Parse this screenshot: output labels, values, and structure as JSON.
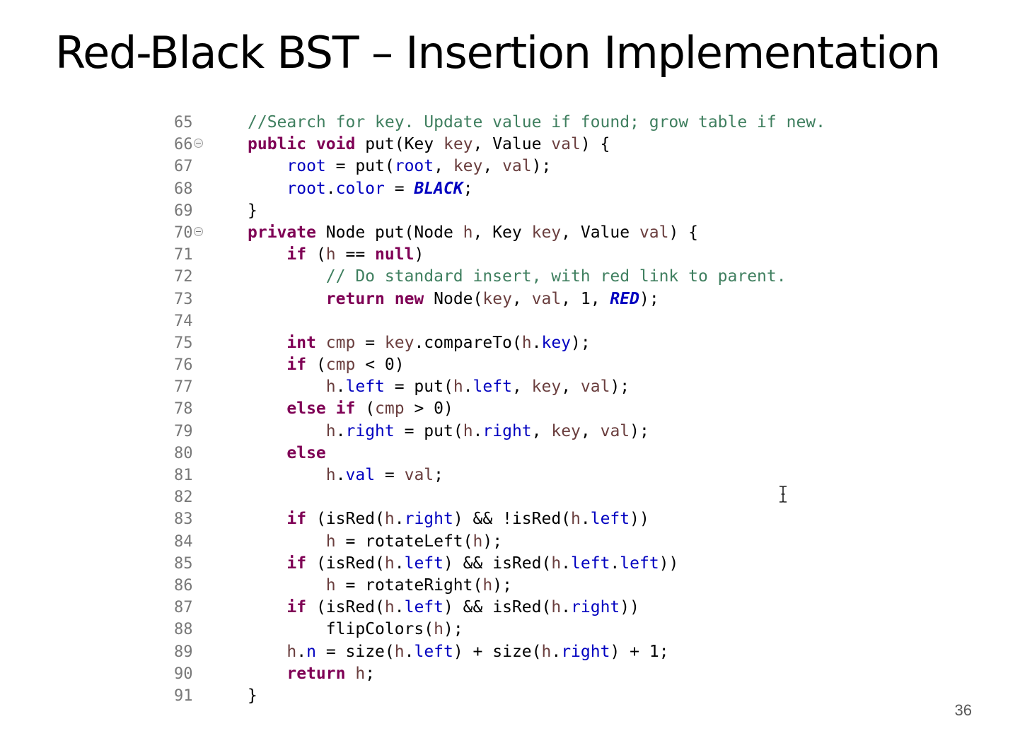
{
  "slide": {
    "title": "Red-Black BST – Insertion Implementation",
    "page_number": "36"
  },
  "code": [
    {
      "num": "65",
      "fold": false,
      "tokens": [
        {
          "t": "//Search for key. Update value if found; grow table if new.",
          "c": "cmt"
        }
      ]
    },
    {
      "num": "66",
      "fold": true,
      "tokens": [
        {
          "t": "public",
          "c": "kw"
        },
        {
          "t": " ",
          "c": "plain"
        },
        {
          "t": "void",
          "c": "kw"
        },
        {
          "t": " put(Key ",
          "c": "plain"
        },
        {
          "t": "key",
          "c": "var"
        },
        {
          "t": ", Value ",
          "c": "plain"
        },
        {
          "t": "val",
          "c": "var"
        },
        {
          "t": ") {",
          "c": "plain"
        }
      ]
    },
    {
      "num": "67",
      "fold": false,
      "tokens": [
        {
          "t": "    ",
          "c": "plain"
        },
        {
          "t": "root",
          "c": "fld"
        },
        {
          "t": " = put(",
          "c": "plain"
        },
        {
          "t": "root",
          "c": "fld"
        },
        {
          "t": ", ",
          "c": "plain"
        },
        {
          "t": "key",
          "c": "var"
        },
        {
          "t": ", ",
          "c": "plain"
        },
        {
          "t": "val",
          "c": "var"
        },
        {
          "t": ");",
          "c": "plain"
        }
      ]
    },
    {
      "num": "68",
      "fold": false,
      "tokens": [
        {
          "t": "    ",
          "c": "plain"
        },
        {
          "t": "root",
          "c": "fld"
        },
        {
          "t": ".",
          "c": "plain"
        },
        {
          "t": "color",
          "c": "fld"
        },
        {
          "t": " = ",
          "c": "plain"
        },
        {
          "t": "BLACK",
          "c": "cnst"
        },
        {
          "t": ";",
          "c": "plain"
        }
      ]
    },
    {
      "num": "69",
      "fold": false,
      "tokens": [
        {
          "t": "}",
          "c": "plain"
        }
      ]
    },
    {
      "num": "70",
      "fold": true,
      "tokens": [
        {
          "t": "private",
          "c": "kw"
        },
        {
          "t": " Node put(Node ",
          "c": "plain"
        },
        {
          "t": "h",
          "c": "var"
        },
        {
          "t": ", Key ",
          "c": "plain"
        },
        {
          "t": "key",
          "c": "var"
        },
        {
          "t": ", Value ",
          "c": "plain"
        },
        {
          "t": "val",
          "c": "var"
        },
        {
          "t": ") {",
          "c": "plain"
        }
      ]
    },
    {
      "num": "71",
      "fold": false,
      "tokens": [
        {
          "t": "    ",
          "c": "plain"
        },
        {
          "t": "if",
          "c": "kw"
        },
        {
          "t": " (",
          "c": "plain"
        },
        {
          "t": "h",
          "c": "var"
        },
        {
          "t": " == ",
          "c": "plain"
        },
        {
          "t": "null",
          "c": "kw"
        },
        {
          "t": ")",
          "c": "plain"
        }
      ]
    },
    {
      "num": "72",
      "fold": false,
      "tokens": [
        {
          "t": "        ",
          "c": "plain"
        },
        {
          "t": "// Do standard insert, with red link to parent.",
          "c": "cmt"
        }
      ]
    },
    {
      "num": "73",
      "fold": false,
      "tokens": [
        {
          "t": "        ",
          "c": "plain"
        },
        {
          "t": "return",
          "c": "kw"
        },
        {
          "t": " ",
          "c": "plain"
        },
        {
          "t": "new",
          "c": "kw"
        },
        {
          "t": " Node(",
          "c": "plain"
        },
        {
          "t": "key",
          "c": "var"
        },
        {
          "t": ", ",
          "c": "plain"
        },
        {
          "t": "val",
          "c": "var"
        },
        {
          "t": ", 1, ",
          "c": "plain"
        },
        {
          "t": "RED",
          "c": "cnst"
        },
        {
          "t": ");",
          "c": "plain"
        }
      ]
    },
    {
      "num": "74",
      "fold": false,
      "tokens": []
    },
    {
      "num": "75",
      "fold": false,
      "tokens": [
        {
          "t": "    ",
          "c": "plain"
        },
        {
          "t": "int",
          "c": "kw"
        },
        {
          "t": " ",
          "c": "plain"
        },
        {
          "t": "cmp",
          "c": "var"
        },
        {
          "t": " = ",
          "c": "plain"
        },
        {
          "t": "key",
          "c": "var"
        },
        {
          "t": ".compareTo(",
          "c": "plain"
        },
        {
          "t": "h",
          "c": "var"
        },
        {
          "t": ".",
          "c": "plain"
        },
        {
          "t": "key",
          "c": "fld"
        },
        {
          "t": ");",
          "c": "plain"
        }
      ]
    },
    {
      "num": "76",
      "fold": false,
      "tokens": [
        {
          "t": "    ",
          "c": "plain"
        },
        {
          "t": "if",
          "c": "kw"
        },
        {
          "t": " (",
          "c": "plain"
        },
        {
          "t": "cmp",
          "c": "var"
        },
        {
          "t": " < 0)",
          "c": "plain"
        }
      ]
    },
    {
      "num": "77",
      "fold": false,
      "tokens": [
        {
          "t": "        ",
          "c": "plain"
        },
        {
          "t": "h",
          "c": "var"
        },
        {
          "t": ".",
          "c": "plain"
        },
        {
          "t": "left",
          "c": "fld"
        },
        {
          "t": " = put(",
          "c": "plain"
        },
        {
          "t": "h",
          "c": "var"
        },
        {
          "t": ".",
          "c": "plain"
        },
        {
          "t": "left",
          "c": "fld"
        },
        {
          "t": ", ",
          "c": "plain"
        },
        {
          "t": "key",
          "c": "var"
        },
        {
          "t": ", ",
          "c": "plain"
        },
        {
          "t": "val",
          "c": "var"
        },
        {
          "t": ");",
          "c": "plain"
        }
      ]
    },
    {
      "num": "78",
      "fold": false,
      "tokens": [
        {
          "t": "    ",
          "c": "plain"
        },
        {
          "t": "else",
          "c": "kw"
        },
        {
          "t": " ",
          "c": "plain"
        },
        {
          "t": "if",
          "c": "kw"
        },
        {
          "t": " (",
          "c": "plain"
        },
        {
          "t": "cmp",
          "c": "var"
        },
        {
          "t": " > 0)",
          "c": "plain"
        }
      ]
    },
    {
      "num": "79",
      "fold": false,
      "tokens": [
        {
          "t": "        ",
          "c": "plain"
        },
        {
          "t": "h",
          "c": "var"
        },
        {
          "t": ".",
          "c": "plain"
        },
        {
          "t": "right",
          "c": "fld"
        },
        {
          "t": " = put(",
          "c": "plain"
        },
        {
          "t": "h",
          "c": "var"
        },
        {
          "t": ".",
          "c": "plain"
        },
        {
          "t": "right",
          "c": "fld"
        },
        {
          "t": ", ",
          "c": "plain"
        },
        {
          "t": "key",
          "c": "var"
        },
        {
          "t": ", ",
          "c": "plain"
        },
        {
          "t": "val",
          "c": "var"
        },
        {
          "t": ");",
          "c": "plain"
        }
      ]
    },
    {
      "num": "80",
      "fold": false,
      "tokens": [
        {
          "t": "    ",
          "c": "plain"
        },
        {
          "t": "else",
          "c": "kw"
        }
      ]
    },
    {
      "num": "81",
      "fold": false,
      "tokens": [
        {
          "t": "        ",
          "c": "plain"
        },
        {
          "t": "h",
          "c": "var"
        },
        {
          "t": ".",
          "c": "plain"
        },
        {
          "t": "val",
          "c": "fld"
        },
        {
          "t": " = ",
          "c": "plain"
        },
        {
          "t": "val",
          "c": "var"
        },
        {
          "t": ";",
          "c": "plain"
        }
      ]
    },
    {
      "num": "82",
      "fold": false,
      "tokens": []
    },
    {
      "num": "83",
      "fold": false,
      "tokens": [
        {
          "t": "    ",
          "c": "plain"
        },
        {
          "t": "if",
          "c": "kw"
        },
        {
          "t": " (isRed(",
          "c": "plain"
        },
        {
          "t": "h",
          "c": "var"
        },
        {
          "t": ".",
          "c": "plain"
        },
        {
          "t": "right",
          "c": "fld"
        },
        {
          "t": ") && !isRed(",
          "c": "plain"
        },
        {
          "t": "h",
          "c": "var"
        },
        {
          "t": ".",
          "c": "plain"
        },
        {
          "t": "left",
          "c": "fld"
        },
        {
          "t": "))",
          "c": "plain"
        }
      ]
    },
    {
      "num": "84",
      "fold": false,
      "tokens": [
        {
          "t": "        ",
          "c": "plain"
        },
        {
          "t": "h",
          "c": "var"
        },
        {
          "t": " = rotateLeft(",
          "c": "plain"
        },
        {
          "t": "h",
          "c": "var"
        },
        {
          "t": ");",
          "c": "plain"
        }
      ]
    },
    {
      "num": "85",
      "fold": false,
      "tokens": [
        {
          "t": "    ",
          "c": "plain"
        },
        {
          "t": "if",
          "c": "kw"
        },
        {
          "t": " (isRed(",
          "c": "plain"
        },
        {
          "t": "h",
          "c": "var"
        },
        {
          "t": ".",
          "c": "plain"
        },
        {
          "t": "left",
          "c": "fld"
        },
        {
          "t": ") && isRed(",
          "c": "plain"
        },
        {
          "t": "h",
          "c": "var"
        },
        {
          "t": ".",
          "c": "plain"
        },
        {
          "t": "left",
          "c": "fld"
        },
        {
          "t": ".",
          "c": "plain"
        },
        {
          "t": "left",
          "c": "fld"
        },
        {
          "t": "))",
          "c": "plain"
        }
      ]
    },
    {
      "num": "86",
      "fold": false,
      "tokens": [
        {
          "t": "        ",
          "c": "plain"
        },
        {
          "t": "h",
          "c": "var"
        },
        {
          "t": " = rotateRight(",
          "c": "plain"
        },
        {
          "t": "h",
          "c": "var"
        },
        {
          "t": ");",
          "c": "plain"
        }
      ]
    },
    {
      "num": "87",
      "fold": false,
      "tokens": [
        {
          "t": "    ",
          "c": "plain"
        },
        {
          "t": "if",
          "c": "kw"
        },
        {
          "t": " (isRed(",
          "c": "plain"
        },
        {
          "t": "h",
          "c": "var"
        },
        {
          "t": ".",
          "c": "plain"
        },
        {
          "t": "left",
          "c": "fld"
        },
        {
          "t": ") && isRed(",
          "c": "plain"
        },
        {
          "t": "h",
          "c": "var"
        },
        {
          "t": ".",
          "c": "plain"
        },
        {
          "t": "right",
          "c": "fld"
        },
        {
          "t": "))",
          "c": "plain"
        }
      ]
    },
    {
      "num": "88",
      "fold": false,
      "tokens": [
        {
          "t": "        ",
          "c": "plain"
        },
        {
          "t": "flipColors(",
          "c": "plain"
        },
        {
          "t": "h",
          "c": "var"
        },
        {
          "t": ");",
          "c": "plain"
        }
      ]
    },
    {
      "num": "89",
      "fold": false,
      "tokens": [
        {
          "t": "    ",
          "c": "plain"
        },
        {
          "t": "h",
          "c": "var"
        },
        {
          "t": ".",
          "c": "plain"
        },
        {
          "t": "n",
          "c": "fld"
        },
        {
          "t": " = size(",
          "c": "plain"
        },
        {
          "t": "h",
          "c": "var"
        },
        {
          "t": ".",
          "c": "plain"
        },
        {
          "t": "left",
          "c": "fld"
        },
        {
          "t": ") + size(",
          "c": "plain"
        },
        {
          "t": "h",
          "c": "var"
        },
        {
          "t": ".",
          "c": "plain"
        },
        {
          "t": "right",
          "c": "fld"
        },
        {
          "t": ") + 1;",
          "c": "plain"
        }
      ]
    },
    {
      "num": "90",
      "fold": false,
      "tokens": [
        {
          "t": "    ",
          "c": "plain"
        },
        {
          "t": "return",
          "c": "kw"
        },
        {
          "t": " ",
          "c": "plain"
        },
        {
          "t": "h",
          "c": "var"
        },
        {
          "t": ";",
          "c": "plain"
        }
      ]
    },
    {
      "num": "91",
      "fold": false,
      "tokens": [
        {
          "t": "}",
          "c": "plain"
        }
      ]
    }
  ],
  "colors": {
    "keyword": "#7f0055",
    "field": "#0000c0",
    "comment": "#3f7f5f",
    "local_variable": "#6a3e3e",
    "line_number": "#787878"
  },
  "icons": {
    "fold_marker": "fold-collapse-icon",
    "cursor": "text-cursor-icon"
  }
}
